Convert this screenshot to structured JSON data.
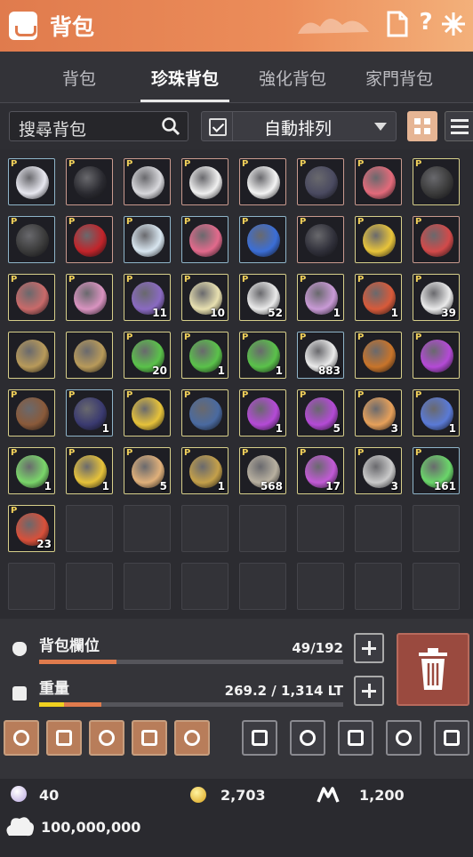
{
  "title": "背包",
  "tabs": [
    {
      "label": "背包",
      "active": false
    },
    {
      "label": "珍珠背包",
      "active": true
    },
    {
      "label": "強化背包",
      "active": false
    },
    {
      "label": "家門背包",
      "active": false
    }
  ],
  "search": {
    "placeholder": "搜尋背包"
  },
  "sort": {
    "label": "自動排列",
    "checked": true
  },
  "slots": [
    {
      "p": true,
      "rarity": "blue",
      "icon": "white-shirt-icon",
      "color": "#e8e8f0",
      "qty": ""
    },
    {
      "p": true,
      "rarity": "red",
      "icon": "dark-armor-icon",
      "color": "#2a2a30",
      "qty": ""
    },
    {
      "p": true,
      "rarity": "red",
      "icon": "white-shoes-icon",
      "color": "#d8d8dc",
      "qty": ""
    },
    {
      "p": true,
      "rarity": "red",
      "icon": "halo-ring-icon",
      "color": "#f0f0f0",
      "qty": ""
    },
    {
      "p": true,
      "rarity": "red",
      "icon": "white-hair-icon",
      "color": "#f4f4f4",
      "qty": ""
    },
    {
      "p": true,
      "rarity": "red",
      "icon": "dark-wing-icon",
      "color": "#4a4a60",
      "qty": ""
    },
    {
      "p": true,
      "rarity": "red",
      "icon": "pink-wig-icon",
      "color": "#e36a7a",
      "qty": ""
    },
    {
      "p": true,
      "rarity": "gold",
      "icon": "grad-cap-icon",
      "color": "#3a3a3a",
      "qty": ""
    },
    {
      "p": true,
      "rarity": "blue",
      "icon": "grad-cap-icon",
      "color": "#3a3a3a",
      "qty": ""
    },
    {
      "p": true,
      "rarity": "red",
      "icon": "santa-hat-icon",
      "color": "#c2242a",
      "qty": ""
    },
    {
      "p": true,
      "rarity": "blue",
      "icon": "sparkle-wand-icon",
      "color": "#d8e6f0",
      "qty": ""
    },
    {
      "p": true,
      "rarity": "blue",
      "icon": "heart-wand-icon",
      "color": "#e26a8c",
      "qty": ""
    },
    {
      "p": true,
      "rarity": "blue",
      "icon": "blue-orb-icon",
      "color": "#3b6ed6",
      "qty": ""
    },
    {
      "p": true,
      "rarity": "red",
      "icon": "dark-orb-icon",
      "color": "#30303a",
      "qty": ""
    },
    {
      "p": true,
      "rarity": "gold",
      "icon": "stars-icon",
      "color": "#e8c43a",
      "qty": ""
    },
    {
      "p": true,
      "rarity": "red",
      "icon": "glasses-icon",
      "color": "#d24a4a",
      "qty": ""
    },
    {
      "p": true,
      "rarity": "gold",
      "icon": "rocket-icon",
      "color": "#c96a6a",
      "qty": ""
    },
    {
      "p": true,
      "rarity": "gold",
      "icon": "feather-pen-icon",
      "color": "#d993c0",
      "qty": ""
    },
    {
      "p": true,
      "rarity": "gold",
      "icon": "scroll-purple-icon",
      "color": "#8a6ac2",
      "qty": "11"
    },
    {
      "p": true,
      "rarity": "gold",
      "icon": "envelope-icon",
      "color": "#e8e0b0",
      "qty": "10"
    },
    {
      "p": true,
      "rarity": "gold",
      "icon": "paper-scroll-icon",
      "color": "#eaeaea",
      "qty": "52"
    },
    {
      "p": true,
      "rarity": "gold",
      "icon": "magic-book-icon",
      "color": "#c99ad6",
      "qty": "1"
    },
    {
      "p": true,
      "rarity": "gold",
      "icon": "red-lantern-icon",
      "color": "#d85a3a",
      "qty": "1"
    },
    {
      "p": true,
      "rarity": "gold",
      "icon": "paper-scroll-icon",
      "color": "#eaeaea",
      "qty": "39"
    },
    {
      "p": false,
      "rarity": "gold",
      "icon": "gold-sphere-icon",
      "color": "#b89a5a",
      "qty": ""
    },
    {
      "p": false,
      "rarity": "gold",
      "icon": "gold-sphere-icon",
      "color": "#b89a5a",
      "qty": ""
    },
    {
      "p": true,
      "rarity": "gold",
      "icon": "green-potion-icon",
      "color": "#5ac24a",
      "qty": "20"
    },
    {
      "p": true,
      "rarity": "gold",
      "icon": "green-potion-icon",
      "color": "#5ac24a",
      "qty": "1"
    },
    {
      "p": true,
      "rarity": "gold",
      "icon": "green-potion-icon",
      "color": "#5ac24a",
      "qty": "1"
    },
    {
      "p": true,
      "rarity": "blue",
      "icon": "paper-scroll-icon",
      "color": "#eaeaea",
      "qty": "883"
    },
    {
      "p": true,
      "rarity": "gold",
      "icon": "treasure-chest-icon",
      "color": "#c8742a",
      "qty": ""
    },
    {
      "p": true,
      "rarity": "gold",
      "icon": "purple-chest-icon",
      "color": "#b44ad6",
      "qty": ""
    },
    {
      "p": true,
      "rarity": "gold",
      "icon": "leather-bag-icon",
      "color": "#8a5a3a",
      "qty": ""
    },
    {
      "p": true,
      "rarity": "blue",
      "icon": "dark-book-icon",
      "color": "#3a3a70",
      "qty": "1"
    },
    {
      "p": true,
      "rarity": "gold",
      "icon": "golden-wing-icon",
      "color": "#e6c23a",
      "qty": ""
    },
    {
      "p": true,
      "rarity": "gold",
      "icon": "anvil-table-icon",
      "color": "#4a6aa0",
      "qty": ""
    },
    {
      "p": true,
      "rarity": "gold",
      "icon": "purple-chest-icon",
      "color": "#b44ad6",
      "qty": "1"
    },
    {
      "p": true,
      "rarity": "gold",
      "icon": "purple-chest-icon",
      "color": "#b44ad6",
      "qty": "5"
    },
    {
      "p": true,
      "rarity": "gold",
      "icon": "ticket-icon",
      "color": "#e6a05a",
      "qty": "3"
    },
    {
      "p": true,
      "rarity": "gold",
      "icon": "blue-potion-icon",
      "color": "#5a7ad6",
      "qty": "1"
    },
    {
      "p": true,
      "rarity": "gold",
      "icon": "green-card-icon",
      "color": "#7ad66a",
      "qty": "1"
    },
    {
      "p": true,
      "rarity": "gold",
      "icon": "golden-quill-icon",
      "color": "#e6c23a",
      "qty": "1"
    },
    {
      "p": true,
      "rarity": "gold",
      "icon": "bone-icon",
      "color": "#e0b07a",
      "qty": "5"
    },
    {
      "p": true,
      "rarity": "gold",
      "icon": "compass-icon",
      "color": "#c4a04a",
      "qty": "1"
    },
    {
      "p": true,
      "rarity": "gold",
      "icon": "pocket-watch-icon",
      "color": "#b8b0a0",
      "qty": "568"
    },
    {
      "p": true,
      "rarity": "gold",
      "icon": "purple-flask-icon",
      "color": "#c25ad6",
      "qty": "17"
    },
    {
      "p": true,
      "rarity": "gold",
      "icon": "silver-leaf-icon",
      "color": "#cacaca",
      "qty": "3"
    },
    {
      "p": true,
      "rarity": "blue",
      "icon": "green-flask-icon",
      "color": "#6ad66a",
      "qty": "161"
    },
    {
      "p": true,
      "rarity": "gold",
      "icon": "red-book-icon",
      "color": "#d8503a",
      "qty": "23"
    }
  ],
  "stats": {
    "slots_label": "背包欄位",
    "slots_value": "49/192",
    "slots_fraction": 0.255,
    "weight_label": "重量",
    "weight_value": "269.2 / 1,314 LT",
    "weight_fraction": 0.205
  },
  "tools": [
    {
      "icon": "sparkle-sword-icon",
      "style": "orange"
    },
    {
      "icon": "diamond-icon",
      "style": "orange"
    },
    {
      "icon": "swirl-icon",
      "style": "orange"
    },
    {
      "icon": "crystal-icon",
      "style": "orange"
    },
    {
      "icon": "grid-icon",
      "style": "orange"
    },
    {
      "icon": "pendant-icon",
      "style": "gray"
    },
    {
      "icon": "hammer-icon",
      "style": "gray"
    },
    {
      "icon": "triskelion-icon",
      "style": "gray"
    },
    {
      "icon": "anvil-icon",
      "style": "gray"
    },
    {
      "icon": "smith-hammer-icon",
      "style": "gray"
    }
  ],
  "currency": {
    "pearl": "40",
    "gold": "2,703",
    "mileage": "1,200",
    "silver": "100,000,000"
  },
  "colors": {
    "accent": "#e07b4d",
    "bar_slots": "#e07b4d",
    "bar_weight_a": "#f0d020",
    "bar_weight_b": "#e07b4d"
  }
}
